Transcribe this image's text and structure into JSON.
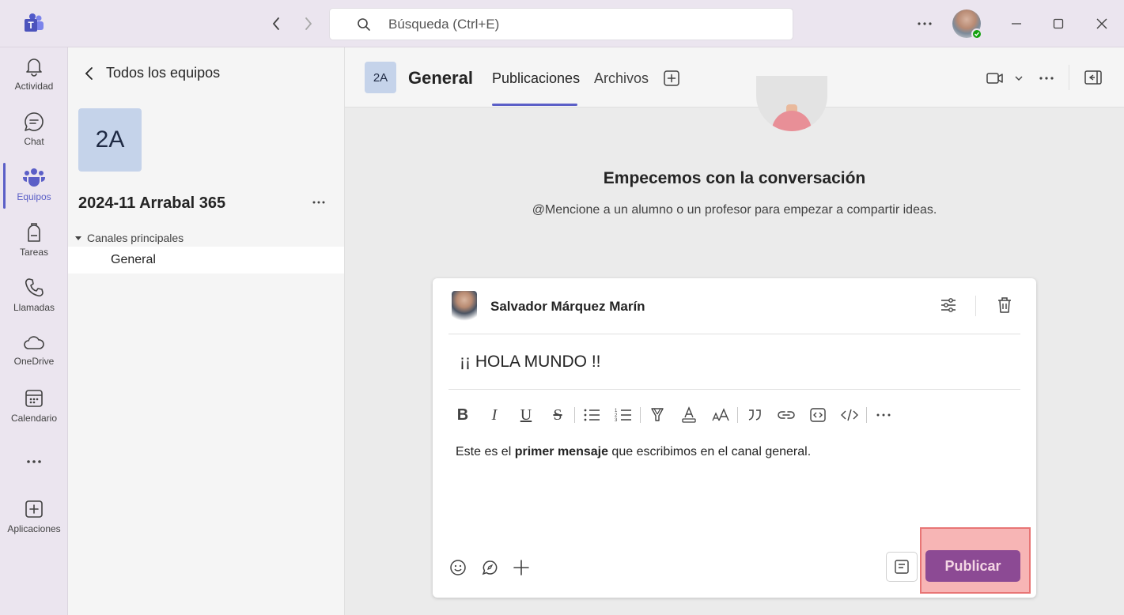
{
  "titlebar": {
    "search_placeholder": "Búsqueda (Ctrl+E)",
    "more_icon": "more-horizontal-icon"
  },
  "rail": {
    "items": [
      {
        "label": "Actividad",
        "icon": "bell-icon"
      },
      {
        "label": "Chat",
        "icon": "chat-icon"
      },
      {
        "label": "Equipos",
        "icon": "teams-icon",
        "active": true
      },
      {
        "label": "Tareas",
        "icon": "backpack-icon"
      },
      {
        "label": "Llamadas",
        "icon": "phone-icon"
      },
      {
        "label": "OneDrive",
        "icon": "cloud-icon"
      },
      {
        "label": "Calendario",
        "icon": "calendar-icon"
      },
      {
        "label": "",
        "icon": "more-horizontal-icon"
      },
      {
        "label": "Aplicaciones",
        "icon": "add-app-icon"
      }
    ]
  },
  "panel": {
    "back_label": "Todos los equipos",
    "team_initials": "2A",
    "team_name": "2024-11 Arrabal 365",
    "section_label": "Canales principales",
    "channel": "General"
  },
  "header": {
    "channel_initials": "2A",
    "channel_title": "General",
    "tabs": [
      {
        "label": "Publicaciones",
        "active": true
      },
      {
        "label": "Archivos",
        "active": false
      }
    ]
  },
  "conversation": {
    "empty_title": "Empecemos con la conversación",
    "empty_subtitle": "@Mencione a un alumno o un profesor para empezar a compartir ideas."
  },
  "compose": {
    "author": "Salvador Márquez Marín",
    "subject": "¡¡ HOLA MUNDO !!",
    "body_before": "Este es el ",
    "body_bold": "primer mensaje",
    "body_after": " que escribimos en el canal general.",
    "format_buttons": [
      "B",
      "I",
      "U",
      "S"
    ],
    "publish_label": "Publicar"
  },
  "colors": {
    "accent": "#5b5fc7",
    "publish": "#8c4a94",
    "highlight": "#f07878"
  }
}
